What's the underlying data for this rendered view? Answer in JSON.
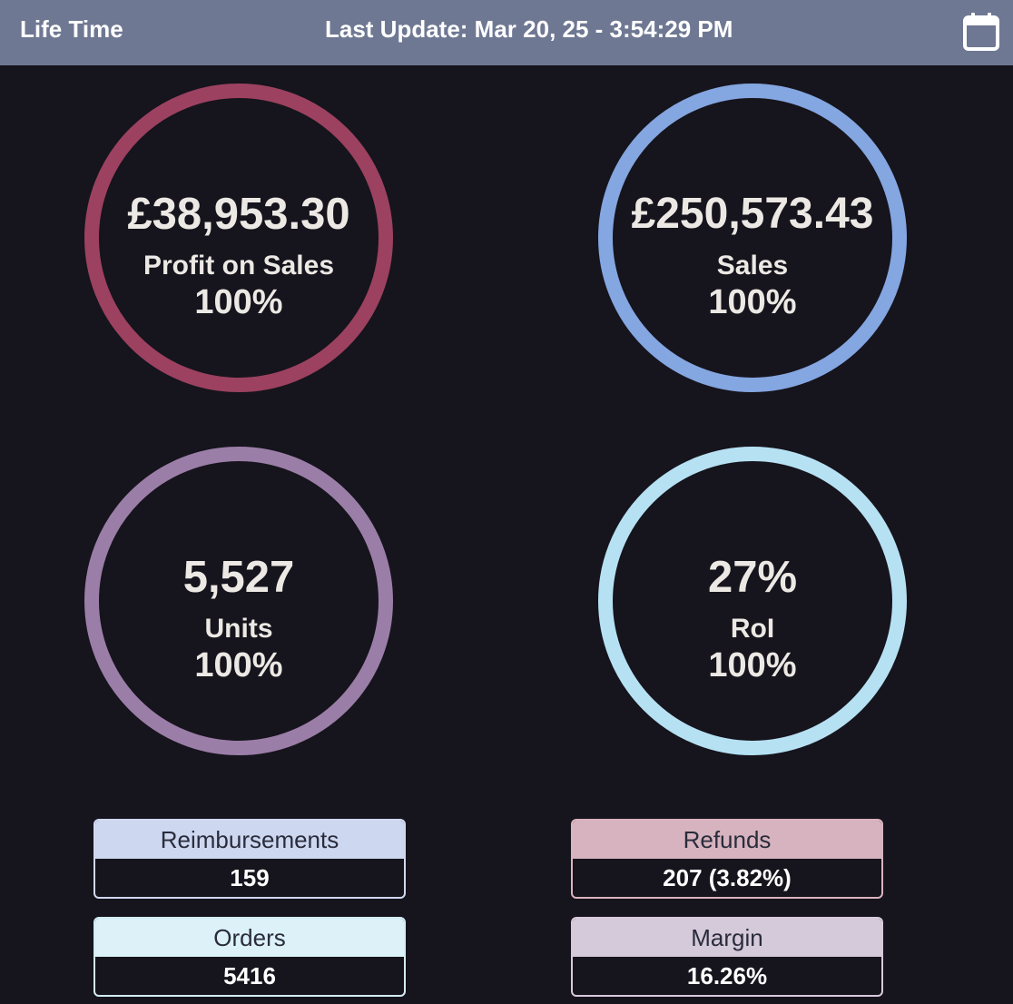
{
  "header": {
    "title": "Life Time",
    "last_update": "Last Update: Mar 20, 25 - 3:54:29 PM",
    "calendar_icon": "calendar-icon"
  },
  "metrics": {
    "profit": {
      "value": "£38,953.30",
      "label": "Profit on Sales",
      "percent": "100%",
      "color": "#9c4160"
    },
    "sales": {
      "value": "£250,573.43",
      "label": "Sales",
      "percent": "100%",
      "color": "#84a6e1"
    },
    "units": {
      "value": "5,527",
      "label": "Units",
      "percent": "100%",
      "color": "#9b7ea8"
    },
    "roi": {
      "value": "27%",
      "label": "RoI",
      "percent": "100%",
      "color": "#b6e1f3"
    }
  },
  "stats": {
    "reimbursements": {
      "label": "Reimbursements",
      "value": "159"
    },
    "refunds": {
      "label": "Refunds",
      "value": "207 (3.82%)"
    },
    "orders": {
      "label": "Orders",
      "value": "5416"
    },
    "margin": {
      "label": "Margin",
      "value": "16.26%"
    }
  }
}
